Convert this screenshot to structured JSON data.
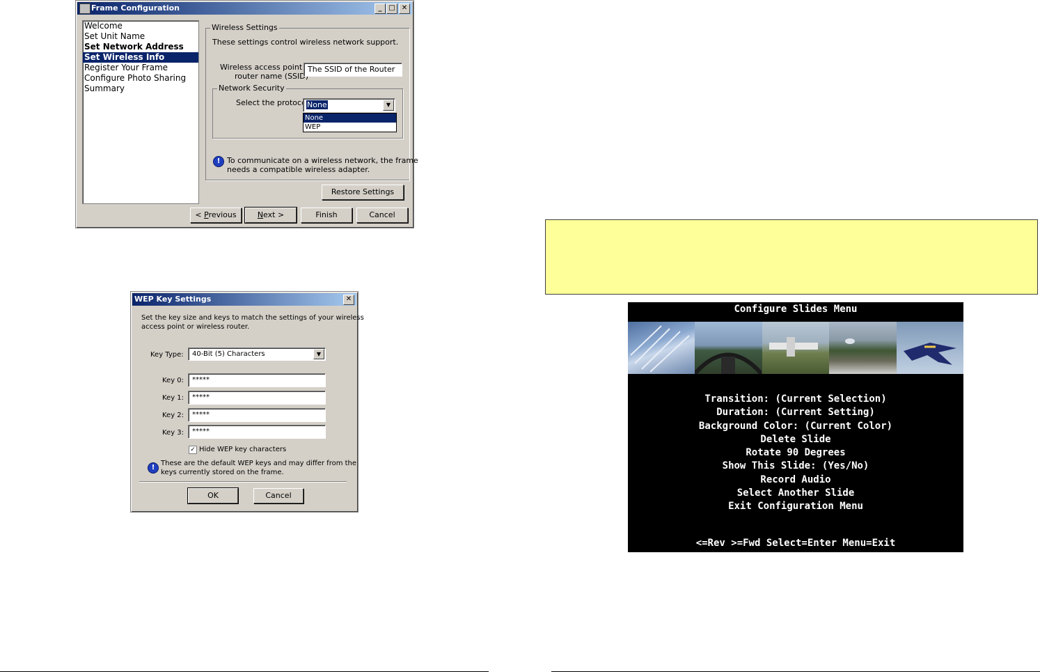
{
  "frame_config": {
    "title": "Frame Configuration",
    "nav": [
      "Welcome",
      "Set Unit Name",
      "Set Network Address",
      "Set Wireless Info",
      "Register Your Frame",
      "Configure Photo Sharing",
      "Summary"
    ],
    "wireless_group_title": "Wireless Settings",
    "description": "These settings control wireless network support.",
    "ssid_label_line1": "Wireless access point or",
    "ssid_label_line2": "router name (SSID)",
    "ssid_value": "The SSID of the Router",
    "security_group_title": "Network Security",
    "protocol_label": "Select the protocol",
    "protocol_value": "None",
    "protocol_options": [
      "None",
      "WEP"
    ],
    "info_line1": "To communicate on a wireless network, the frame",
    "info_line2": "needs a compatible wireless adapter.",
    "restore_button": "Restore Settings",
    "previous_button_pre": "< ",
    "previous_button_u": "P",
    "previous_button_post": "revious",
    "next_button_u": "N",
    "next_button_post": "ext >",
    "finish_button": "Finish",
    "cancel_button": "Cancel"
  },
  "wep_dialog": {
    "title": "WEP Key Settings",
    "desc_line1": "Set the key size and keys to match the settings of your wireless",
    "desc_line2": "access point or wireless router.",
    "key_type_label": "Key Type:",
    "key_type_value": "40-Bit (5) Characters",
    "keys": [
      {
        "label": "Key 0:",
        "value": "*****"
      },
      {
        "label": "Key 1:",
        "value": "*****"
      },
      {
        "label": "Key 2:",
        "value": "*****"
      },
      {
        "label": "Key 3:",
        "value": "*****"
      }
    ],
    "hide_label": "Hide WEP key characters",
    "note_line1": "These are the default WEP keys and may differ from the",
    "note_line2": "keys currently stored on the frame.",
    "ok_button": "OK",
    "cancel_button": "Cancel"
  },
  "slides_menu": {
    "title": "Configure Slides Menu",
    "items": [
      "Transition: (Current Selection)",
      "Duration: (Current Setting)",
      "Background Color: (Current Color)",
      "Delete Slide",
      "Rotate 90 Degrees",
      "Show This Slide: (Yes/No)",
      "Record Audio",
      "Select Another Slide",
      "Exit Configuration Menu"
    ],
    "footer": "<=Rev >=Fwd Select=Enter Menu=Exit"
  }
}
